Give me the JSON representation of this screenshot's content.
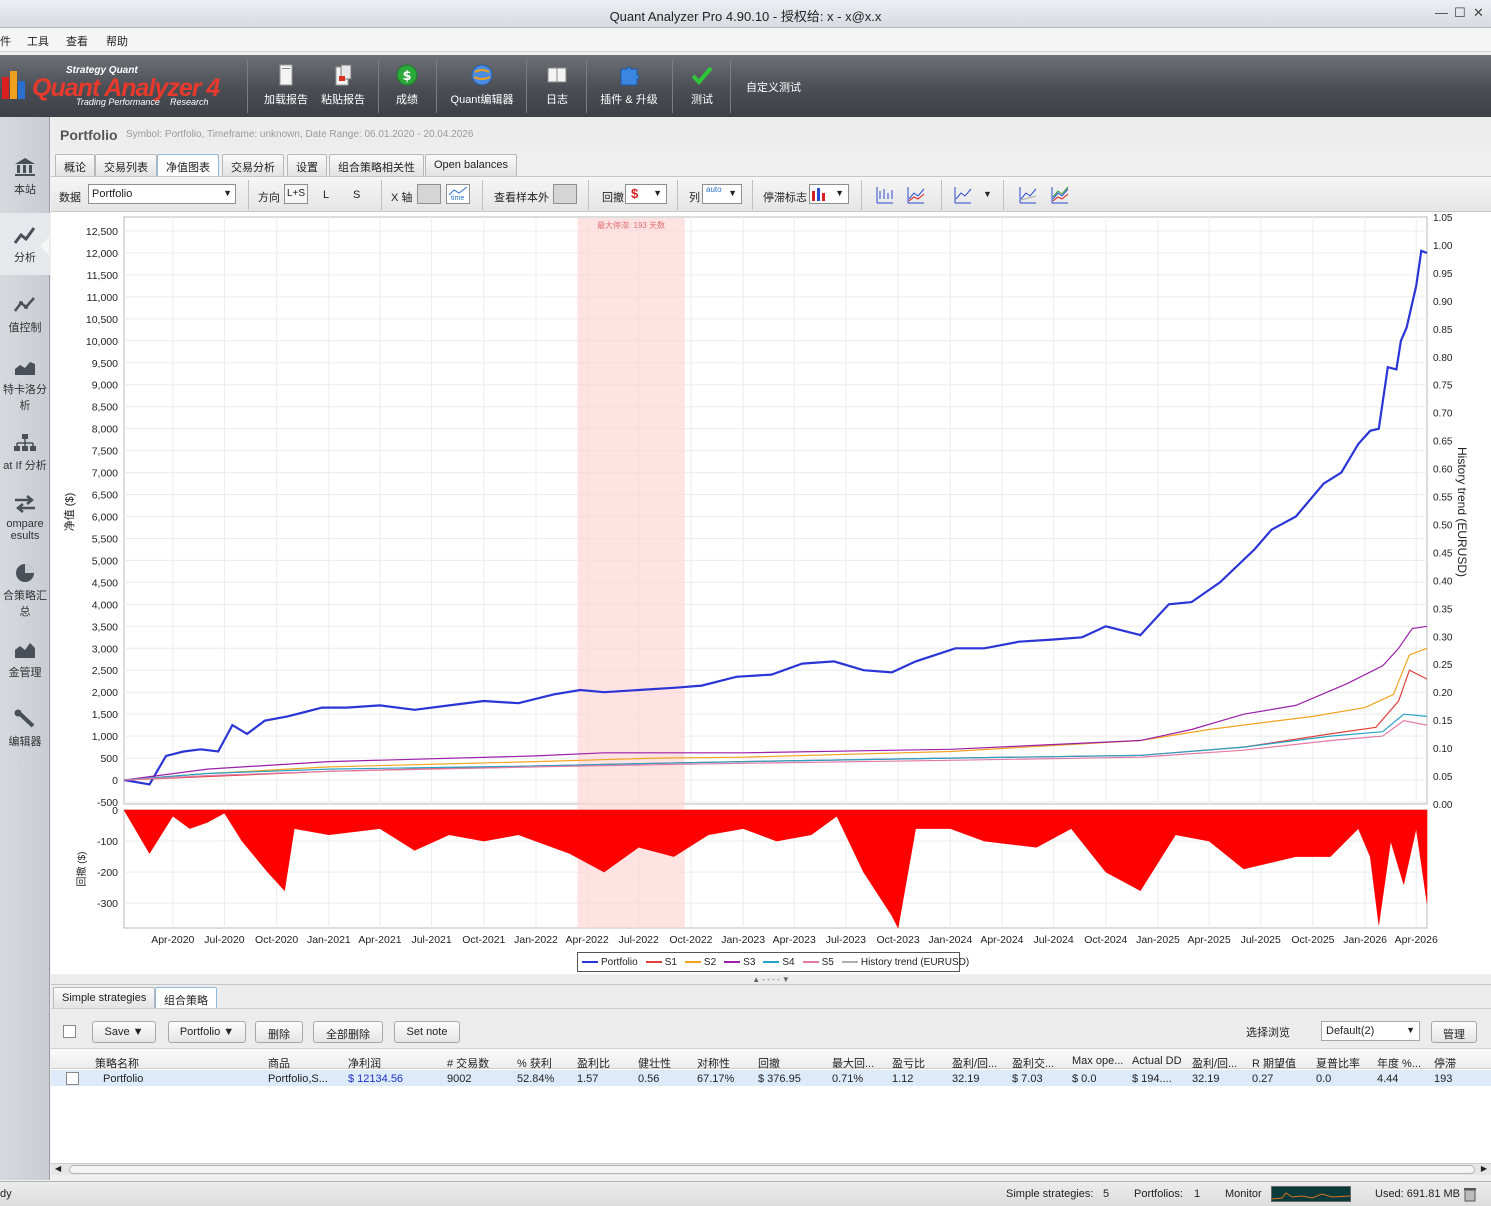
{
  "window": {
    "title": "Quant Analyzer Pro 4.90.10 - 授权给: x - x@x.x",
    "min_icon": "minimize-icon",
    "max_icon": "maximize-icon",
    "close_icon": "close-icon"
  },
  "menu": [
    "件",
    "工具",
    "查看",
    "帮助"
  ],
  "ribbon": {
    "logo_brand": "Strategy Quant",
    "logo_product": "Quant Analyzer 4",
    "logo_tag_left": "Trading Performance",
    "logo_tag_right": "Research",
    "buttons": [
      {
        "label": "加载报告",
        "icon": "load-report-icon"
      },
      {
        "label": "粘贴报告",
        "icon": "paste-report-icon"
      },
      {
        "label": "成绩",
        "icon": "dollar-icon"
      },
      {
        "label": "Quant编辑器",
        "icon": "globe-icon"
      },
      {
        "label": "日志",
        "icon": "book-icon"
      },
      {
        "label": "插件 & 升级",
        "icon": "puzzle-icon"
      },
      {
        "label": "测试",
        "icon": "checkmark-icon"
      }
    ],
    "custom_test": "自定义测试"
  },
  "sidebar": [
    {
      "label": "本站",
      "icon": "bank-icon"
    },
    {
      "label": "分析",
      "icon": "analysis-chart-icon"
    },
    {
      "label": "值控制",
      "icon": "line-chart-icon"
    },
    {
      "label": "特卡洛分析",
      "icon": "area-chart-icon"
    },
    {
      "label": "at If 分析",
      "icon": "hierarchy-icon"
    },
    {
      "label": "ompare esults",
      "icon": "compare-arrows-icon"
    },
    {
      "label": "合策略汇总",
      "icon": "pie-chart-icon"
    },
    {
      "label": "金管理",
      "icon": "bar-chart-icon"
    },
    {
      "label": "编辑器",
      "icon": "wrench-icon"
    }
  ],
  "header": {
    "title": "Portfolio",
    "subtitle": "Symbol: Portfolio, Timeframe: unknown, Date Range: 06.01.2020 - 20.04.2026"
  },
  "tabs": [
    "概论",
    "交易列表",
    "净值图表",
    "交易分析",
    "设置",
    "组合策略相关性",
    "Open balances"
  ],
  "active_tab": 2,
  "toolbar": {
    "data_label": "数据",
    "data_value": "Portfolio",
    "direction_label": "方向",
    "dir_ls": "L+S",
    "dir_l": "L",
    "dir_s": "S",
    "xaxis_label": "X 轴",
    "time_label": "time",
    "oos_label": "查看样本外",
    "dd_label": "回撤",
    "col_label": "列",
    "auto_label": "auto",
    "stag_label": "停滞标志"
  },
  "chart_data": {
    "type": "line",
    "drawdown_label": "最大停滞: 193 天数",
    "ylabel": "净值 ($)",
    "y2label": "History trend (EURUSD)",
    "dd_ylabel": "回撤 ($)",
    "ylim": [
      -500,
      12500
    ],
    "yticks": [
      "12,500",
      "12,000",
      "11,500",
      "11,000",
      "10,500",
      "10,000",
      "9,500",
      "9,000",
      "8,500",
      "8,000",
      "7,500",
      "7,000",
      "6,500",
      "6,000",
      "5,500",
      "5,000",
      "4,500",
      "4,000",
      "3,500",
      "3,000",
      "2,500",
      "2,000",
      "1,500",
      "1,000",
      "500",
      "0",
      "-500"
    ],
    "y2ticks": [
      "1.05",
      "1.00",
      "0.95",
      "0.90",
      "0.85",
      "0.80",
      "0.75",
      "0.70",
      "0.65",
      "0.60",
      "0.55",
      "0.50",
      "0.45",
      "0.40",
      "0.35",
      "0.30",
      "0.25",
      "0.20",
      "0.15",
      "0.10",
      "0.05",
      "0.00"
    ],
    "dd_ylim": [
      -380,
      0
    ],
    "dd_yticks": [
      "0",
      "-100",
      "-200",
      "-300"
    ],
    "x_ticks": [
      "Apr-2020",
      "Jul-2020",
      "Oct-2020",
      "Jan-2021",
      "Apr-2021",
      "Jul-2021",
      "Oct-2021",
      "Jan-2022",
      "Apr-2022",
      "Jul-2022",
      "Oct-2022",
      "Jan-2023",
      "Apr-2023",
      "Jul-2023",
      "Oct-2023",
      "Jan-2024",
      "Apr-2024",
      "Jul-2024",
      "Oct-2024",
      "Jan-2025",
      "Apr-2025",
      "Jul-2025",
      "Oct-2025",
      "Jan-2026",
      "Apr-2026"
    ],
    "x_start": "2020-01-06",
    "x_end": "2026-04-20",
    "stagnation": {
      "from": "2022-03-15",
      "to": "2022-09-20"
    },
    "series": [
      {
        "name": "Portfolio",
        "color": "#2b35d6",
        "x": [
          "2020-01-06",
          "2020-02-20",
          "2020-03-20",
          "2020-04-20",
          "2020-05-20",
          "2020-06-20",
          "2020-07-15",
          "2020-08-10",
          "2020-09-10",
          "2020-10-20",
          "2020-11-20",
          "2020-12-20",
          "2021-02-01",
          "2021-04-01",
          "2021-06-01",
          "2021-08-01",
          "2021-10-01",
          "2021-12-01",
          "2022-02-01",
          "2022-03-20",
          "2022-05-01",
          "2022-07-01",
          "2022-09-01",
          "2022-10-20",
          "2022-12-20",
          "2023-02-20",
          "2023-04-15",
          "2023-06-10",
          "2023-08-01",
          "2023-09-20",
          "2023-11-01",
          "2024-01-10",
          "2024-03-01",
          "2024-05-01",
          "2024-07-01",
          "2024-08-20",
          "2024-10-01",
          "2024-12-01",
          "2025-01-20",
          "2025-03-01",
          "2025-04-20",
          "2025-06-20",
          "2025-07-20",
          "2025-09-01",
          "2025-10-20",
          "2025-11-20",
          "2025-12-20",
          "2026-01-10",
          "2026-01-25",
          "2026-02-10",
          "2026-02-25",
          "2026-03-05",
          "2026-03-15",
          "2026-04-01",
          "2026-04-10",
          "2026-04-20"
        ],
        "values": [
          0,
          -100,
          550,
          650,
          700,
          650,
          1250,
          1050,
          1350,
          1450,
          1550,
          1650,
          1650,
          1700,
          1600,
          1700,
          1800,
          1750,
          1950,
          2050,
          2000,
          2050,
          2100,
          2150,
          2350,
          2400,
          2650,
          2700,
          2500,
          2450,
          2700,
          3000,
          3000,
          3150,
          3200,
          3250,
          3500,
          3300,
          4000,
          4050,
          4500,
          5250,
          5700,
          6000,
          6750,
          7000,
          7650,
          7950,
          8000,
          9400,
          9350,
          10000,
          10300,
          11250,
          12050,
          12000
        ]
      },
      {
        "name": "S1",
        "color": "#e0403a",
        "x": [
          "2020-01-06",
          "2020-06-01",
          "2021-01-01",
          "2022-01-01",
          "2022-08-01",
          "2023-01-01",
          "2024-01-01",
          "2024-12-01",
          "2025-06-01",
          "2025-11-01",
          "2026-01-20",
          "2026-03-01",
          "2026-03-20",
          "2026-04-20"
        ],
        "values": [
          0,
          80,
          200,
          320,
          380,
          420,
          500,
          560,
          750,
          1050,
          1200,
          1800,
          2500,
          2300
        ]
      },
      {
        "name": "S2",
        "color": "#f2a31f",
        "x": [
          "2020-01-06",
          "2020-06-01",
          "2021-01-01",
          "2022-01-01",
          "2022-08-01",
          "2023-01-01",
          "2024-01-01",
          "2024-12-01",
          "2025-04-01",
          "2025-07-01",
          "2025-10-01",
          "2026-01-01",
          "2026-02-20",
          "2026-03-20",
          "2026-04-20"
        ],
        "values": [
          0,
          150,
          300,
          420,
          500,
          520,
          650,
          900,
          1150,
          1300,
          1450,
          1650,
          1950,
          2850,
          3000
        ]
      },
      {
        "name": "S3",
        "color": "#9b1fa8",
        "x": [
          "2020-01-06",
          "2020-06-01",
          "2021-01-01",
          "2022-01-01",
          "2022-05-01",
          "2023-01-01",
          "2024-01-01",
          "2024-12-01",
          "2025-03-01",
          "2025-06-01",
          "2025-09-01",
          "2025-12-01",
          "2026-02-01",
          "2026-03-01",
          "2026-03-25",
          "2026-04-20"
        ],
        "values": [
          0,
          250,
          420,
          550,
          620,
          620,
          700,
          900,
          1150,
          1500,
          1700,
          2200,
          2600,
          3000,
          3450,
          3500
        ]
      },
      {
        "name": "S4",
        "color": "#27a3c9",
        "x": [
          "2020-01-06",
          "2020-06-01",
          "2021-01-01",
          "2022-01-01",
          "2022-08-01",
          "2023-01-01",
          "2024-01-01",
          "2024-12-01",
          "2025-06-01",
          "2025-11-01",
          "2026-02-01",
          "2026-03-10",
          "2026-04-20"
        ],
        "values": [
          0,
          150,
          250,
          320,
          380,
          420,
          500,
          560,
          750,
          1000,
          1100,
          1500,
          1450
        ]
      },
      {
        "name": "S5",
        "color": "#e27aa8",
        "x": [
          "2020-01-06",
          "2020-06-01",
          "2021-01-01",
          "2022-01-01",
          "2022-08-01",
          "2023-01-01",
          "2024-01-01",
          "2024-12-01",
          "2025-06-01",
          "2025-11-01",
          "2026-02-01",
          "2026-03-10",
          "2026-04-20"
        ],
        "values": [
          0,
          100,
          200,
          300,
          350,
          380,
          450,
          520,
          680,
          900,
          1000,
          1350,
          1250
        ]
      },
      {
        "name": "History trend (EURUSD)",
        "color": "#b0b0b0",
        "x": [],
        "values": []
      }
    ],
    "drawdown": {
      "color": "#ff0000",
      "x": [
        "2020-01-06",
        "2020-02-20",
        "2020-04-01",
        "2020-05-01",
        "2020-06-01",
        "2020-07-01",
        "2020-08-01",
        "2020-09-15",
        "2020-10-15",
        "2020-11-01",
        "2021-01-01",
        "2021-04-01",
        "2021-06-01",
        "2021-08-01",
        "2021-10-01",
        "2021-12-01",
        "2022-03-01",
        "2022-05-01",
        "2022-07-01",
        "2022-09-01",
        "2022-11-01",
        "2023-01-01",
        "2023-03-01",
        "2023-05-01",
        "2023-06-15",
        "2023-08-01",
        "2023-09-20",
        "2023-10-01",
        "2023-11-01",
        "2024-01-01",
        "2024-03-01",
        "2024-06-01",
        "2024-08-01",
        "2024-10-01",
        "2024-12-01",
        "2025-02-01",
        "2025-04-01",
        "2025-06-01",
        "2025-09-01",
        "2025-11-01",
        "2025-12-20",
        "2026-01-10",
        "2026-01-25",
        "2026-02-15",
        "2026-03-10",
        "2026-04-01",
        "2026-04-20"
      ],
      "values": [
        0,
        -140,
        -20,
        -60,
        -40,
        -10,
        -100,
        -200,
        -260,
        -60,
        -80,
        -60,
        -130,
        -80,
        -100,
        -80,
        -140,
        -200,
        -120,
        -150,
        -80,
        -60,
        -100,
        -80,
        -20,
        -200,
        -340,
        -380,
        -60,
        -60,
        -100,
        -120,
        -60,
        -200,
        -260,
        -80,
        -100,
        -190,
        -150,
        -150,
        -60,
        -150,
        -370,
        -100,
        -240,
        -60,
        -300
      ]
    }
  },
  "bottom_tabs": [
    "Simple strategies",
    "组合策略"
  ],
  "actions": {
    "save": "Save ▼",
    "portfolio": "Portfolio ▼",
    "delete": "删除",
    "delete_all": "全部删除",
    "set_note": "Set note",
    "view_label": "选择浏览",
    "view_value": "Default(2)",
    "manage": "管理"
  },
  "table": {
    "headers": [
      "策略名称",
      "商品",
      "净利润",
      "# 交易数",
      "% 获利",
      "盈利比",
      "健壮性",
      "对称性",
      "回撤",
      "最大回...",
      "盈亏比",
      "盈利/回...",
      "盈利交...",
      "Max ope...",
      "Actual DD",
      "盈利/回...",
      "R 期望值",
      "夏普比率",
      "年度 %...",
      "停滞"
    ],
    "rows": [
      [
        "Portfolio",
        "Portfolio,S...",
        "$ 12134.56",
        "9002",
        "52.84%",
        "1.57",
        "0.56",
        "67.17%",
        "$ 376.95",
        "0.71%",
        "1.12",
        "32.19",
        "$ 7.03",
        "$ 0.0",
        "$ 194....",
        "32.19",
        "0.27",
        "0.0",
        "4.44",
        "193"
      ]
    ]
  },
  "status": {
    "ready": "dy",
    "simple_label": "Simple strategies:",
    "simple_count": "5",
    "portfolios_label": "Portfolios:",
    "portfolios_count": "1",
    "monitor": "Monitor",
    "used": "Used: 691.81 MB"
  }
}
